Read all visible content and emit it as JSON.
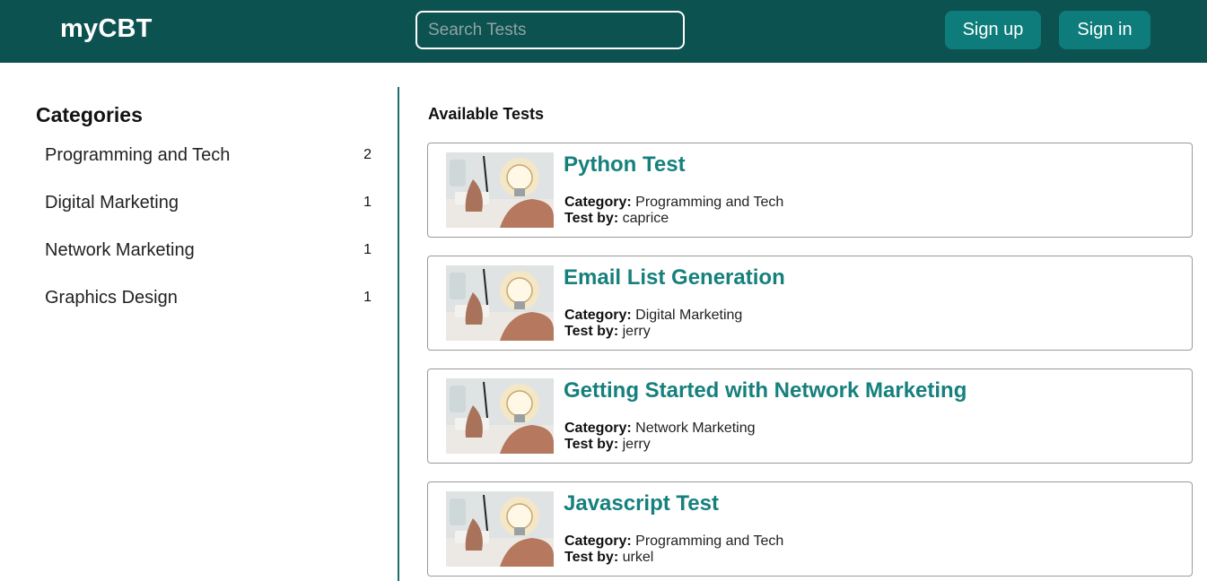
{
  "header": {
    "brand": "myCBT",
    "search_placeholder": "Search Tests",
    "signup_label": "Sign up",
    "signin_label": "Sign in"
  },
  "sidebar": {
    "title": "Categories",
    "items": [
      {
        "label": "Programming and Tech",
        "count": "2"
      },
      {
        "label": "Digital Marketing",
        "count": "1"
      },
      {
        "label": "Network Marketing",
        "count": "1"
      },
      {
        "label": "Graphics Design",
        "count": "1"
      }
    ]
  },
  "main": {
    "title": "Available Tests",
    "category_label": "Category:",
    "author_label": "Test by:",
    "tests": [
      {
        "title": "Python Test",
        "category": "Programming and Tech",
        "author": "caprice"
      },
      {
        "title": "Email List Generation",
        "category": "Digital Marketing",
        "author": "jerry"
      },
      {
        "title": "Getting Started with Network Marketing",
        "category": "Network Marketing",
        "author": "jerry"
      },
      {
        "title": "Javascript Test",
        "category": "Programming and Tech",
        "author": "urkel"
      }
    ]
  },
  "colors": {
    "header_bg": "#0c5250",
    "accent": "#0d7c7a",
    "title_text": "#16807d"
  },
  "icons": [
    "lightbulb-thumbnail"
  ]
}
